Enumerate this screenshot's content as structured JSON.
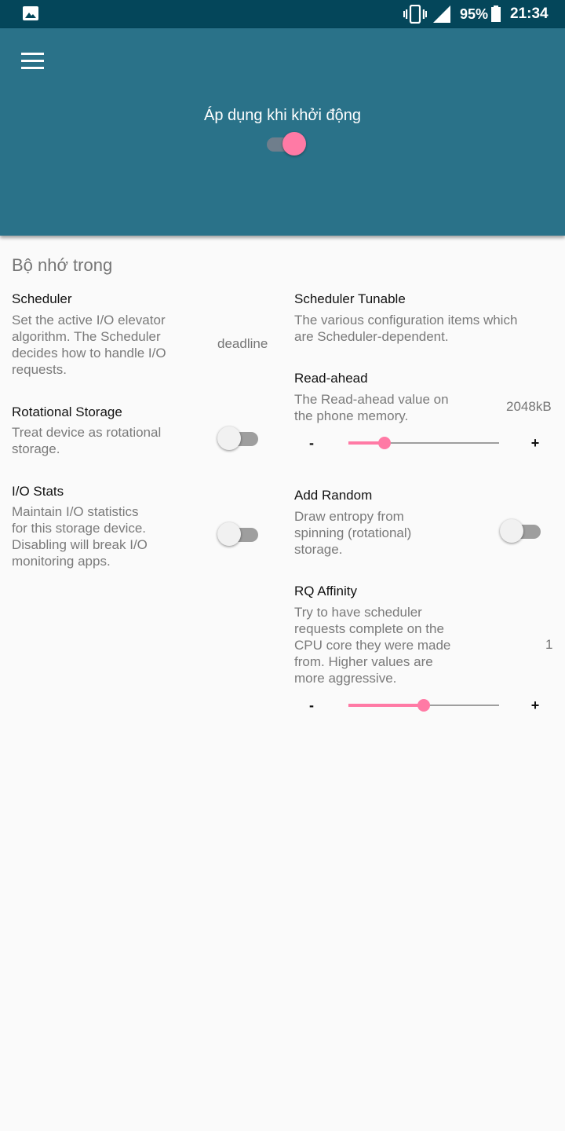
{
  "status_bar": {
    "battery": "95%",
    "time": "21:34"
  },
  "header": {
    "boot_label": "Áp dụng khi khởi động",
    "boot_enabled": true
  },
  "section": {
    "title": "Bộ nhớ trong"
  },
  "left": {
    "scheduler": {
      "title": "Scheduler",
      "desc": [
        "Set the active I/O elevator",
        "algorithm. The Scheduler",
        "decides how to handle I/O",
        "requests."
      ],
      "value": "deadline"
    },
    "rotational": {
      "title": "Rotational Storage",
      "desc": [
        "Treat device as rotational",
        "storage."
      ],
      "enabled": false
    },
    "iostats": {
      "title": "I/O Stats",
      "desc": [
        "Maintain I/O statistics",
        "for this storage device.",
        "Disabling will break I/O",
        "monitoring apps."
      ],
      "enabled": false
    }
  },
  "right": {
    "tunable": {
      "title": "Scheduler Tunable",
      "desc": [
        "The various configuration items which",
        "are Scheduler-dependent."
      ]
    },
    "readahead": {
      "title": "Read-ahead",
      "desc": [
        "The Read-ahead value on",
        "the phone memory."
      ],
      "value": "2048kB",
      "slider_fraction": 0.24,
      "minus": "-",
      "plus": "+"
    },
    "addrandom": {
      "title": "Add Random",
      "desc": [
        "Draw entropy from",
        "spinning (rotational)",
        "storage."
      ],
      "enabled": false
    },
    "rqaffinity": {
      "title": "RQ Affinity",
      "desc": [
        "Try to have scheduler",
        "requests complete on the",
        "CPU core they were made",
        "from. Higher values are",
        "more aggressive."
      ],
      "value": "1",
      "slider_fraction": 0.5,
      "minus": "-",
      "plus": "+"
    }
  },
  "colors": {
    "status_bar": "#04465a",
    "app_bar": "#2a7289",
    "accent": "#ff7aa5",
    "background": "#fafafa"
  }
}
